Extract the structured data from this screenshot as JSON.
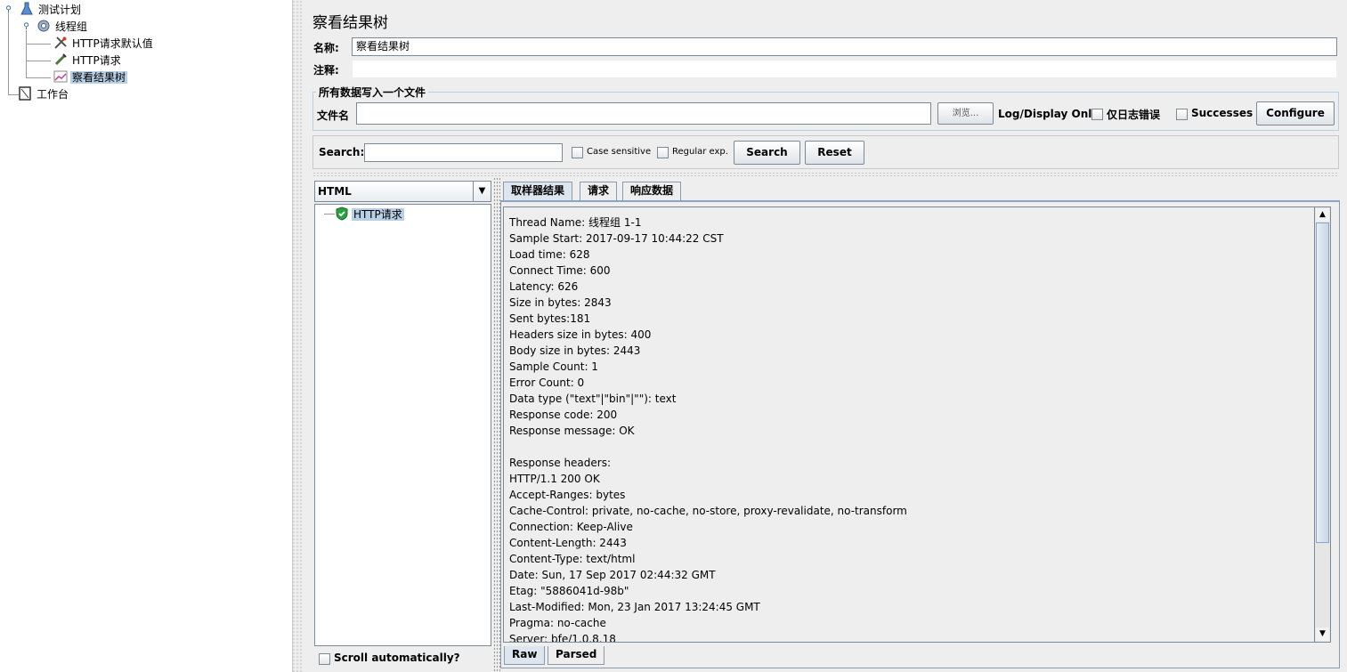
{
  "tree": {
    "items": [
      {
        "label": "测试计划",
        "icon": "flask-icon"
      },
      {
        "label": "线程组",
        "icon": "gear-icon"
      },
      {
        "label": "HTTP请求默认值",
        "icon": "wrench-icon"
      },
      {
        "label": "HTTP请求",
        "icon": "pipette-icon"
      },
      {
        "label": "察看结果树",
        "icon": "chart-icon"
      },
      {
        "label": "工作台",
        "icon": "notebook-icon"
      }
    ]
  },
  "panel": {
    "title": "察看结果树",
    "name_label": "名称:",
    "name_value": "察看结果树",
    "comment_label": "注释:",
    "file_group_title": "所有数据写入一个文件",
    "filename_label": "文件名",
    "browse_button": "浏览...",
    "log_display_label": "Log/Display Only:",
    "errors_only_label": "仅日志错误",
    "successes_label": "Successes",
    "configure_button": "Configure"
  },
  "search": {
    "label": "Search:",
    "case_sensitive": "Case sensitive",
    "regular_exp": "Regular exp.",
    "search_button": "Search",
    "reset_button": "Reset"
  },
  "results": {
    "renderer": "HTML",
    "sample_label": "HTTP请求",
    "scroll_auto": "Scroll automatically?",
    "tabs": [
      "取样器结果",
      "请求",
      "响应数据"
    ],
    "bottom_tabs": [
      "Raw",
      "Parsed"
    ],
    "lines": [
      "Thread Name: 线程组 1-1",
      "Sample Start: 2017-09-17 10:44:22 CST",
      "Load time: 628",
      "Connect Time: 600",
      "Latency: 626",
      "Size in bytes: 2843",
      "Sent bytes:181",
      "Headers size in bytes: 400",
      "Body size in bytes: 2443",
      "Sample Count: 1",
      "Error Count: 0",
      "Data type (\"text\"|\"bin\"|\"\"): text",
      "Response code: 200",
      "Response message: OK",
      "",
      "Response headers:",
      "HTTP/1.1 200 OK",
      "Accept-Ranges: bytes",
      "Cache-Control: private, no-cache, no-store, proxy-revalidate, no-transform",
      "Connection: Keep-Alive",
      "Content-Length: 2443",
      "Content-Type: text/html",
      "Date: Sun, 17 Sep 2017 02:44:32 GMT",
      "Etag: \"5886041d-98b\"",
      "Last-Modified: Mon, 23 Jan 2017 13:24:45 GMT",
      "Pragma: no-cache",
      "Server: bfe/1.0.8.18"
    ]
  }
}
